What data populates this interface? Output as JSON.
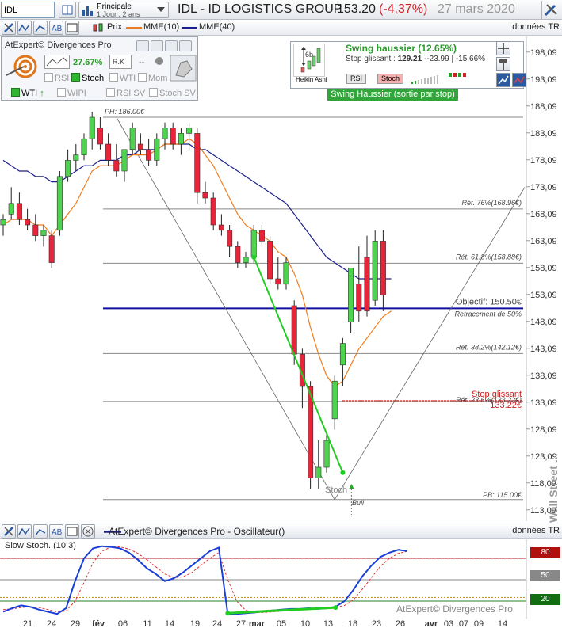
{
  "toolbar": {
    "symbol": "IDL",
    "period_line1": "Principale",
    "period_line2": "1 Jour , 2 ans",
    "title": "IDL - ID LOGISTICS GROUP",
    "price": "153.20",
    "change": "(-4,37%)",
    "date": "27 mars 2020"
  },
  "legend": {
    "prix": "Prix",
    "mme10": "MME(10)",
    "mme40": "MME(40)",
    "source": "données TR"
  },
  "atexpert": {
    "title": "AtExpert© Divergences Pro",
    "pct": "27.67%",
    "dash": "--",
    "cb_rsi": "RSI",
    "cb_stoch": "Stoch",
    "cb_wti_top": "WTI",
    "cb_mom": "Mom",
    "cb_wti": "WTI",
    "cb_wipi": "WIPI",
    "cb_rsisv": "RSI SV",
    "cb_stochsv": "Stoch SV"
  },
  "swing": {
    "title": "Swing haussier (12.65%)",
    "stop_label": "Stop glissant :",
    "stop_value": "129.21",
    "stop_detail": "-23.99 | -15.66%",
    "heikin": "Heikin Ashi",
    "period": "6b",
    "rsi_tab": "RSI",
    "stoch_tab": "Stoch",
    "banner": "Swing Haussier (sortie par stop)"
  },
  "annotations": {
    "ph": "PH: 186.00€",
    "pb": "PB: 115.00€",
    "ret76": "Rét. 76%(168.96€)",
    "ret618": "Rét. 61.8%(158.88€)",
    "objectif": "Objectif: 150.50€",
    "ret50": "Retracement de 50%",
    "ret382": "Rét. 38.2%(142.12€)",
    "stop_label": "Stop glissant",
    "stop_value": "133.22€",
    "ret236": "Rét. 23.6%(133.22€)",
    "stoch_label": "Stoch",
    "bull_label": "Bull"
  },
  "yaxis": [
    "198,09",
    "193,09",
    "188,09",
    "183,09",
    "178,09",
    "173,09",
    "168,09",
    "163,09",
    "158,09",
    "153,09",
    "148,09",
    "143,09",
    "138,09",
    "133,09",
    "128,09",
    "123,09",
    "118,09",
    "113,09"
  ],
  "xaxis": [
    "21",
    "24",
    "29",
    "fév",
    "06",
    "11",
    "14",
    "19",
    "24",
    "27",
    "mar",
    "05",
    "10",
    "13",
    "18",
    "23",
    "26",
    "avr",
    "03",
    "07",
    "09",
    "14"
  ],
  "oscillator": {
    "title": "AtExpert© Divergences Pro - Oscillateur()",
    "source": "données TR",
    "slow_label": "Slow Stoch. (10,3)",
    "levels": [
      "80",
      "50",
      "20"
    ],
    "watermark": "AtExpert© Divergences Pro",
    "side_watermark": "Wall Street ...",
    "k": [
      5,
      10,
      14,
      12,
      8,
      5,
      2,
      10,
      48,
      80,
      94,
      97,
      96,
      94,
      88,
      78,
      66,
      58,
      48,
      52,
      60,
      70,
      80,
      90,
      95,
      2,
      2,
      3,
      4,
      6,
      7,
      8,
      9,
      9,
      10,
      9,
      10,
      12,
      20,
      36,
      55,
      70,
      82,
      88,
      92,
      90
    ],
    "d": [
      8,
      9,
      11,
      12,
      11,
      8,
      5,
      6,
      20,
      46,
      74,
      90,
      96,
      96,
      93,
      87,
      78,
      68,
      58,
      53,
      54,
      60,
      70,
      80,
      88,
      50,
      20,
      7,
      4,
      4,
      5,
      6,
      7,
      8,
      9,
      9,
      10,
      11,
      14,
      22,
      37,
      53,
      69,
      80,
      87,
      90
    ]
  },
  "chart_data": {
    "type": "candlestick",
    "title": "IDL - ID LOGISTICS GROUP",
    "x": [
      "21",
      "22",
      "23",
      "24",
      "27",
      "28",
      "29",
      "30",
      "31",
      "fév",
      "04",
      "05",
      "06",
      "07",
      "10",
      "11",
      "12",
      "13",
      "14",
      "17",
      "18",
      "19",
      "20",
      "21",
      "24",
      "25",
      "26",
      "27",
      "28",
      "mar",
      "03",
      "04",
      "05",
      "06",
      "09",
      "10",
      "11",
      "12",
      "13",
      "16",
      "17",
      "18",
      "19",
      "20",
      "23",
      "24",
      "25",
      "26",
      "27"
    ],
    "series": [
      {
        "name": "Prix",
        "ohlc": [
          [
            166,
            168,
            164,
            167
          ],
          [
            168,
            173,
            167,
            170
          ],
          [
            170,
            172,
            166,
            167
          ],
          [
            167,
            169,
            165,
            166
          ],
          [
            166,
            168,
            163,
            164
          ],
          [
            164,
            166,
            162,
            165
          ],
          [
            164,
            165,
            158,
            159
          ],
          [
            165,
            176,
            164,
            175
          ],
          [
            175,
            180,
            174,
            178
          ],
          [
            178,
            181,
            176,
            179
          ],
          [
            179,
            183,
            178,
            182
          ],
          [
            182,
            187,
            180,
            186
          ],
          [
            184,
            186,
            180,
            181
          ],
          [
            181,
            183,
            177,
            178
          ],
          [
            178,
            181,
            175,
            176
          ],
          [
            176,
            180,
            174,
            180
          ],
          [
            180,
            185,
            179,
            184
          ],
          [
            181,
            183,
            179,
            180
          ],
          [
            180,
            182,
            177,
            178
          ],
          [
            178,
            183,
            177,
            182
          ],
          [
            182,
            185,
            180,
            184
          ],
          [
            184,
            185,
            180,
            181
          ],
          [
            181,
            184,
            179,
            183
          ],
          [
            183,
            185,
            180,
            184
          ],
          [
            183,
            184,
            170,
            172
          ],
          [
            172,
            174,
            170,
            171
          ],
          [
            171,
            172,
            165,
            166
          ],
          [
            166,
            168,
            164,
            165
          ],
          [
            165,
            166,
            160,
            162
          ],
          [
            162,
            163,
            158,
            159
          ],
          [
            159,
            161,
            158,
            160
          ],
          [
            160,
            166,
            159,
            165
          ],
          [
            165,
            166,
            162,
            163
          ],
          [
            163,
            164,
            155,
            156
          ],
          [
            156,
            160,
            154,
            155
          ],
          [
            155,
            160,
            154,
            159
          ],
          [
            151,
            152,
            140,
            142
          ],
          [
            142,
            143,
            132,
            136
          ],
          [
            136,
            137,
            117,
            119
          ],
          [
            119,
            126,
            117,
            121
          ],
          [
            121,
            127,
            120,
            126
          ],
          [
            130,
            138,
            128,
            137
          ],
          [
            140,
            145,
            136,
            144
          ],
          [
            148,
            156,
            146,
            158
          ],
          [
            155,
            162,
            148,
            150
          ],
          [
            160,
            164,
            149,
            150
          ],
          [
            152,
            165,
            151,
            163
          ],
          [
            163,
            165,
            150,
            153
          ]
        ]
      },
      {
        "name": "MME(10)",
        "values": [
          166,
          167,
          167,
          167,
          166,
          166,
          164,
          166,
          168,
          170,
          173,
          176,
          177,
          177,
          177,
          178,
          179,
          179,
          179,
          180,
          181,
          181,
          181,
          182,
          181,
          179,
          177,
          174,
          171,
          168,
          166,
          165,
          164,
          163,
          161,
          160,
          157,
          153,
          147,
          142,
          138,
          136,
          137,
          140,
          143,
          145,
          147,
          149,
          150
        ]
      },
      {
        "name": "MME(40)",
        "values": [
          178,
          177,
          176,
          176,
          175,
          175,
          174,
          174,
          175,
          176,
          177,
          177,
          178,
          178,
          178,
          179,
          179,
          180,
          180,
          180,
          181,
          181,
          181,
          181,
          180,
          180,
          179,
          178,
          177,
          176,
          175,
          174,
          173,
          172,
          171,
          170,
          168,
          166,
          164,
          162,
          160,
          159,
          158,
          157,
          156,
          156,
          156,
          156,
          156
        ]
      }
    ],
    "ylim": [
      111,
      201
    ],
    "levels": {
      "ph": 186.0,
      "pb": 115.0,
      "ret76": 168.96,
      "ret618": 158.88,
      "objectif": 150.5,
      "ret382": 142.12,
      "ret236": 133.22,
      "stop": 133.22
    }
  }
}
